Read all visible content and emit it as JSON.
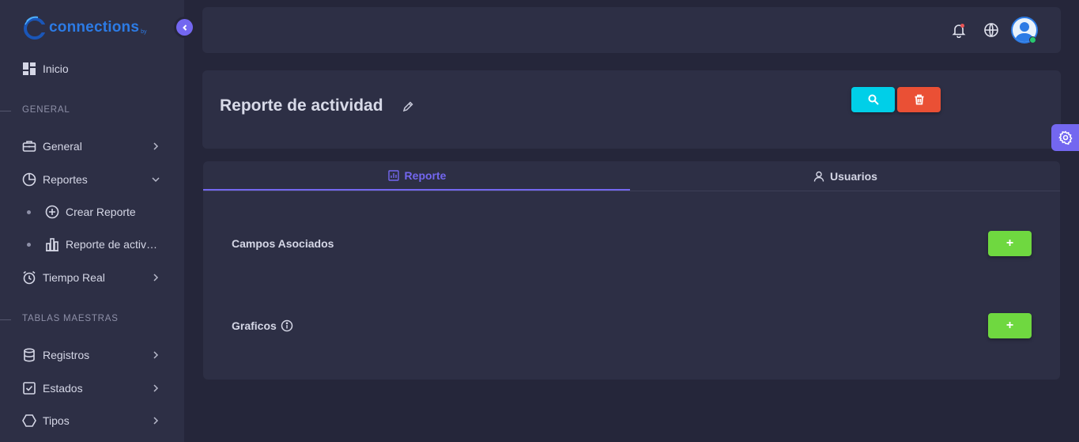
{
  "app": {
    "logo_text": "connections",
    "logo_sub": "by"
  },
  "sidebar": {
    "home": {
      "label": "Inicio"
    },
    "sections": [
      {
        "title": "GENERAL"
      },
      {
        "title": "TABLAS MAESTRAS"
      }
    ],
    "general_items": [
      {
        "label": "General",
        "icon": "briefcase-icon",
        "expanded": false
      },
      {
        "label": "Reportes",
        "icon": "pie-chart-icon",
        "expanded": true
      },
      {
        "label": "Tiempo Real",
        "icon": "alarm-clock-icon",
        "expanded": false
      }
    ],
    "reportes_sub": [
      {
        "label": "Crear Reporte",
        "icon": "plus-circle-icon"
      },
      {
        "label": "Reporte de actividad",
        "icon": "bar-chart-icon"
      }
    ],
    "master_items": [
      {
        "label": "Registros",
        "icon": "database-icon"
      },
      {
        "label": "Estados",
        "icon": "check-square-icon"
      },
      {
        "label": "Tipos",
        "icon": "hexagon-icon"
      }
    ]
  },
  "header": {
    "title": "Reporte de actividad",
    "search_button_icon": "search-icon",
    "delete_button_icon": "trash-icon"
  },
  "tabs": [
    {
      "label": "Reporte",
      "icon": "bar-chart-icon",
      "active": true
    },
    {
      "label": "Usuarios",
      "icon": "user-icon",
      "active": false
    }
  ],
  "sections": {
    "campos": {
      "label": "Campos Asociados",
      "add_label": "+"
    },
    "graficos": {
      "label": "Graficos",
      "add_label": "+"
    }
  },
  "colors": {
    "accent": "#7367f0",
    "search_btn": "#00cfe8",
    "delete_btn": "#ea5035",
    "add_btn": "#6fd840",
    "online": "#28c76f"
  }
}
